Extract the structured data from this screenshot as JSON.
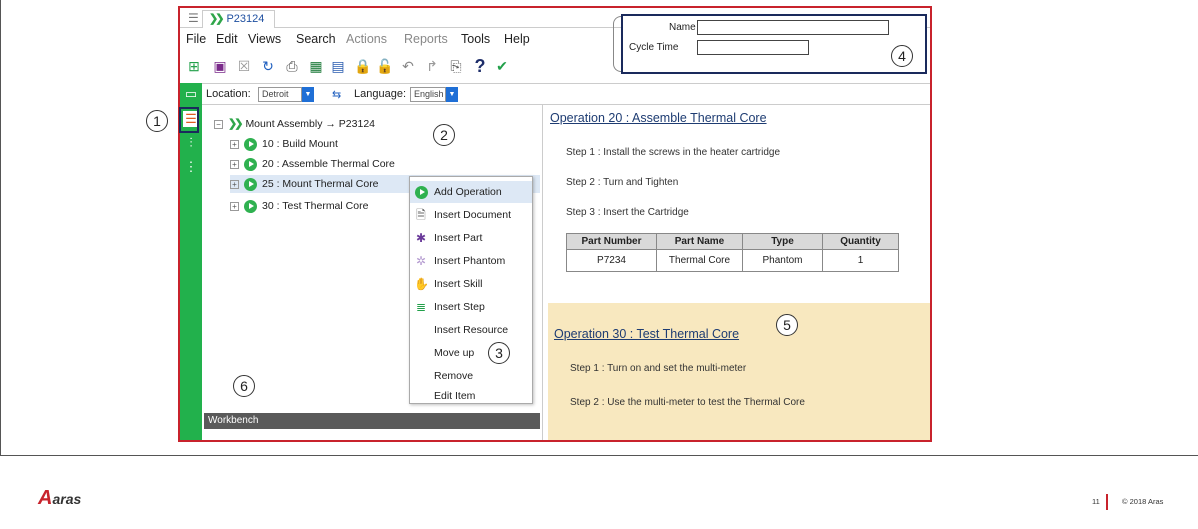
{
  "window": {
    "tab_label": "P23124"
  },
  "menu": [
    "File",
    "Edit",
    "Views",
    "Search",
    "Actions",
    "Reports",
    "Tools",
    "Help"
  ],
  "location_bar": {
    "location_label": "Location:",
    "location_value": "Detroit",
    "language_label": "Language:",
    "language_value": "English"
  },
  "tree": {
    "root": "Mount Assembly → P23124",
    "items": [
      "10 : Build Mount",
      "20 : Assemble Thermal Core",
      "25 : Mount Thermal Core",
      "30 : Test Thermal Core"
    ]
  },
  "context_menu": [
    "Add Operation",
    "Insert Document",
    "Insert Part",
    "Insert Phantom",
    "Insert Skill",
    "Insert Step",
    "Insert Resource",
    "Move up",
    "Remove",
    "Edit Item"
  ],
  "workbench": {
    "label": "Workbench"
  },
  "operation20": {
    "title": "Operation 20 : Assemble Thermal Core",
    "steps": [
      "Step 1 : Install the screws in the heater cartridge",
      "Step 2 : Turn and Tighten",
      "Step 3 : Insert the Cartridge"
    ],
    "table": {
      "headers": [
        "Part Number",
        "Part Name",
        "Type",
        "Quantity"
      ],
      "rows": [
        [
          "P7234",
          "Thermal Core",
          "Phantom",
          "1"
        ]
      ]
    }
  },
  "operation30": {
    "title": "Operation 30 : Test Thermal Core",
    "steps": [
      "Step 1 : Turn on and set the multi-meter",
      "Step 2 : Use the multi-meter to test the Thermal Core"
    ]
  },
  "properties": {
    "name_label": "Name",
    "cycle_time_label": "Cycle Time"
  },
  "callouts": [
    "1",
    "2",
    "3",
    "4",
    "5",
    "6"
  ],
  "footer": {
    "logo_text": "aras",
    "page_number": "11",
    "copyright": "© 2018 Aras"
  },
  "colors": {
    "accent_green": "#22b14c",
    "highlight_red": "#c8232c",
    "callout_navy": "#1a2a5c",
    "selection_yellow": "#f8e8bf"
  }
}
